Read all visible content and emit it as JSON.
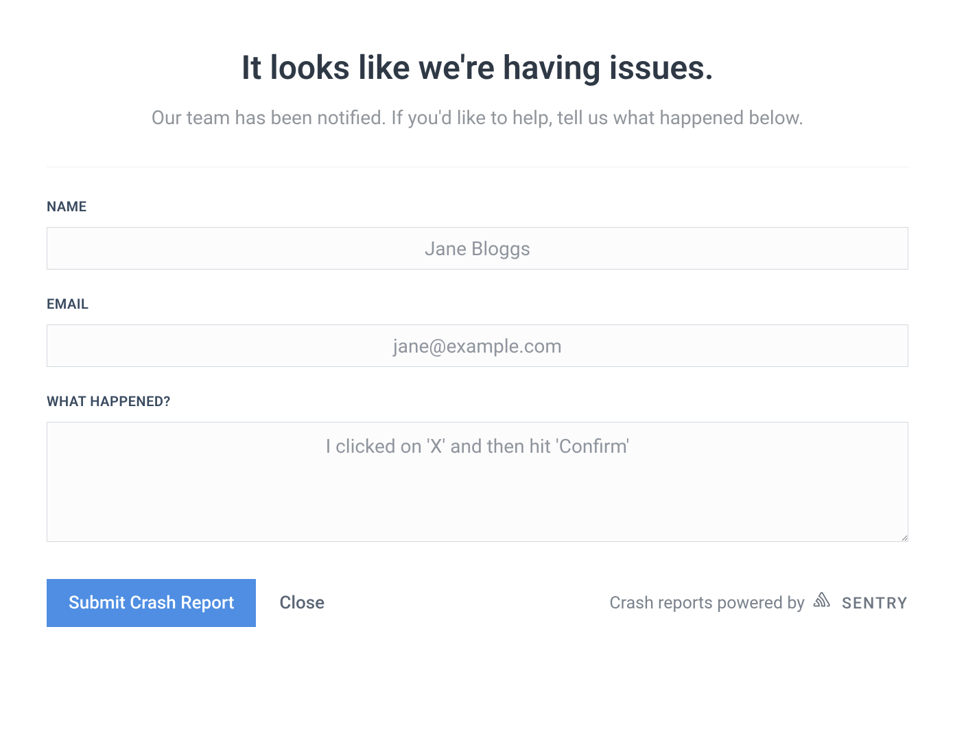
{
  "header": {
    "title": "It looks like we're having issues.",
    "subtitle": "Our team has been notified. If you'd like to help, tell us what happened below."
  },
  "form": {
    "name": {
      "label": "NAME",
      "placeholder": "Jane Bloggs",
      "value": ""
    },
    "email": {
      "label": "EMAIL",
      "placeholder": "jane@example.com",
      "value": ""
    },
    "description": {
      "label": "WHAT HAPPENED?",
      "placeholder": "I clicked on 'X' and then hit 'Confirm'",
      "value": ""
    }
  },
  "actions": {
    "submit_label": "Submit Crash Report",
    "close_label": "Close"
  },
  "footer": {
    "powered_by_text": "Crash reports powered by",
    "brand": "SENTRY"
  }
}
